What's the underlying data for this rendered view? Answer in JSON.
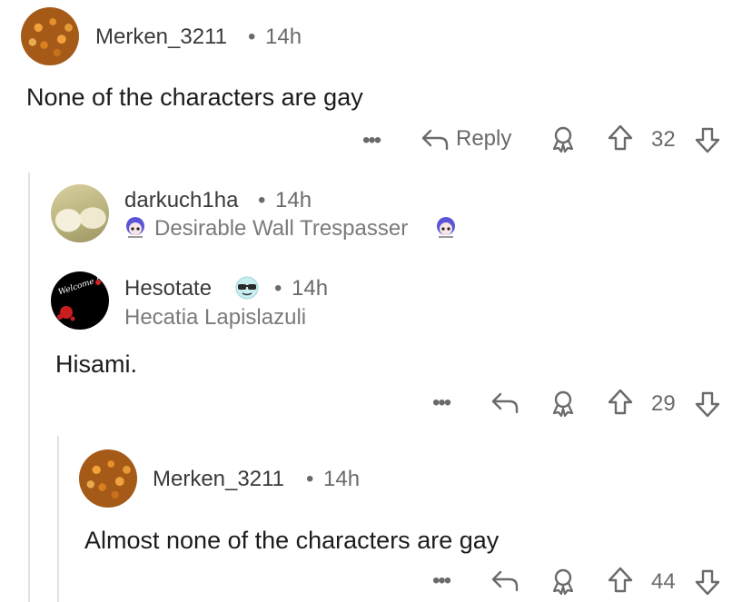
{
  "comments": [
    {
      "username": "Merken_3211",
      "separator": "•",
      "time": "14h",
      "body": "None of the characters are gay",
      "actions": {
        "more": "•••",
        "reply": "Reply",
        "score": "32"
      }
    },
    {
      "username": "darkuch1ha",
      "separator": "•",
      "time": "14h",
      "flair": "Desirable Wall Trespasser"
    },
    {
      "username": "Hesotate",
      "separator": "•",
      "time": "14h",
      "flair": "Hecatia Lapislazuli",
      "body": "Hisami.",
      "avatar_text": "Welcome Hell",
      "actions": {
        "more": "•••",
        "score": "29"
      }
    },
    {
      "username": "Merken_3211",
      "separator": "•",
      "time": "14h",
      "body": "Almost none of the characters are gay",
      "actions": {
        "more": "•••",
        "score": "44"
      }
    }
  ],
  "colors": {
    "thread_line": "#e2e2e2",
    "meta_text": "#6a6a6a"
  },
  "icons": [
    "reply-arrow-icon",
    "award-icon",
    "upvote-icon",
    "downvote-icon",
    "more-options-icon",
    "flair-emoji-icon",
    "sunglasses-emoji-icon"
  ]
}
